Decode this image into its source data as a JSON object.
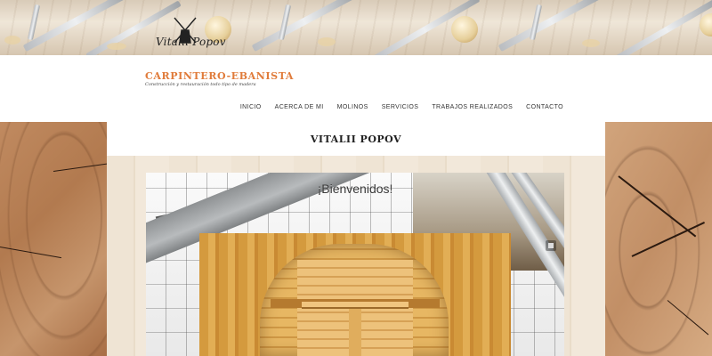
{
  "logo": {
    "text": "Vitalii Popov"
  },
  "header": {
    "site_title": "CARPINTERO-EBANISTA",
    "tagline": "Construcción y restauración todo tipo de madera"
  },
  "nav": {
    "items": [
      {
        "label": "INICIO"
      },
      {
        "label": "ACERCA DE MI"
      },
      {
        "label": "MOLINOS"
      },
      {
        "label": "SERVICIOS"
      },
      {
        "label": "TRABAJOS REALIZADOS"
      },
      {
        "label": "CONTACTO"
      }
    ]
  },
  "main": {
    "page_title": "VITALII POPOV",
    "slider": {
      "caption": "¡Bienvenidos!"
    }
  },
  "colors": {
    "accent": "#e07b3a",
    "text": "#333333",
    "title": "#222222"
  }
}
